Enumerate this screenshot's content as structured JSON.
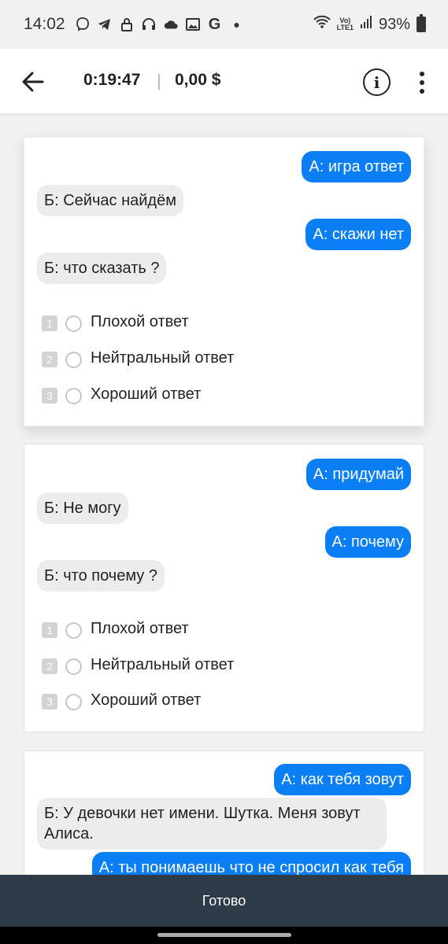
{
  "status_bar": {
    "time": "14:02",
    "icons": [
      "viber-icon",
      "telegram-icon",
      "lock-icon",
      "headset-icon",
      "cloud-icon",
      "image-icon",
      "google-icon",
      "dot-icon"
    ],
    "network_top": "Vo)",
    "network_bottom": "LTE1",
    "battery": "93%"
  },
  "appbar": {
    "timer": "0:19:47",
    "separator": "|",
    "balance": "0,00 $",
    "info_glyph": "i"
  },
  "cards": [
    {
      "messages": [
        {
          "side": "a",
          "text": "А: игра ответ"
        },
        {
          "side": "b",
          "text": "Б: Сейчас найдём"
        },
        {
          "side": "a",
          "text": "А: скажи нет"
        },
        {
          "side": "b",
          "text": "Б: что сказать ?"
        }
      ],
      "options": [
        {
          "num": "1",
          "label": "Плохой ответ"
        },
        {
          "num": "2",
          "label": "Нейтральный ответ"
        },
        {
          "num": "3",
          "label": "Хороший ответ"
        }
      ]
    },
    {
      "messages": [
        {
          "side": "a",
          "text": "А: придумай"
        },
        {
          "side": "b",
          "text": "Б: Не могу"
        },
        {
          "side": "a",
          "text": "А: почему"
        },
        {
          "side": "b",
          "text": "Б: что почему ?"
        }
      ],
      "options": [
        {
          "num": "1",
          "label": "Плохой ответ"
        },
        {
          "num": "2",
          "label": "Нейтральный ответ"
        },
        {
          "num": "3",
          "label": "Хороший ответ"
        }
      ]
    },
    {
      "messages": [
        {
          "side": "a",
          "text": "А: как тебя зовут"
        },
        {
          "side": "b",
          "text": "Б: У девочки нет имени. Шутка. Меня зовут Алиса."
        },
        {
          "side": "a",
          "text": "А: ты понимаешь что не спросил как тебя"
        }
      ]
    }
  ],
  "bottom_button": "Готово"
}
